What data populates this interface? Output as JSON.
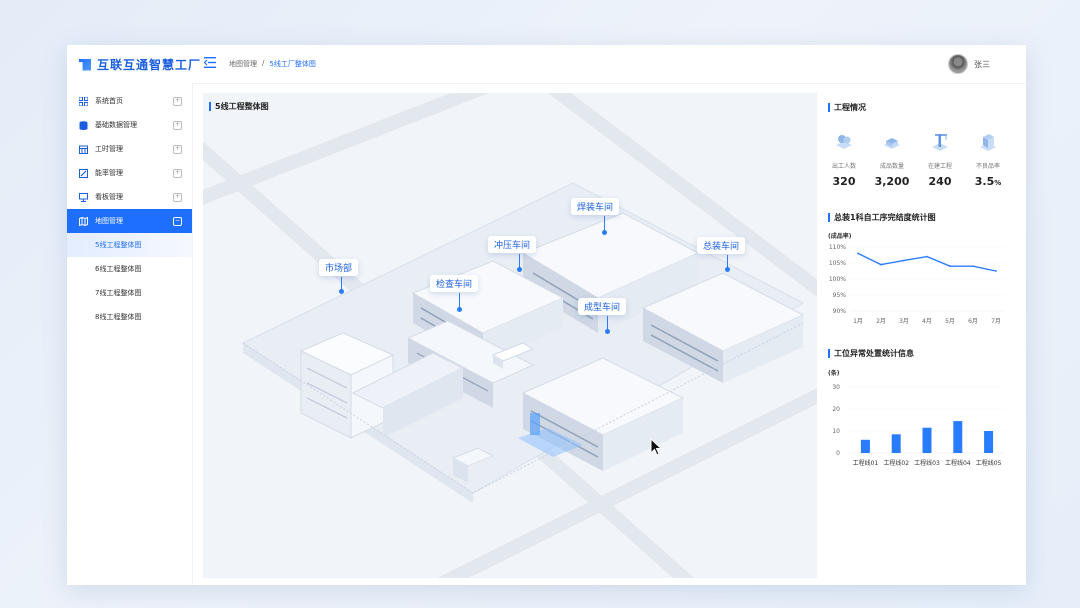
{
  "app": {
    "title": "互联互通智慧工厂"
  },
  "header": {
    "breadcrumb": [
      "地图管理",
      "/",
      "5线工厂整体图"
    ],
    "user_name": "张三"
  },
  "sidebar": {
    "items": [
      {
        "label": "系统首页",
        "icon": "grid-icon"
      },
      {
        "label": "基础数据管理",
        "icon": "database-icon"
      },
      {
        "label": "工时管理",
        "icon": "calendar-icon"
      },
      {
        "label": "能率管理",
        "icon": "chart-edit-icon"
      },
      {
        "label": "看板管理",
        "icon": "board-icon"
      },
      {
        "label": "地图管理",
        "icon": "map-icon",
        "active": true
      }
    ],
    "sub_items": [
      "5线工程整体图",
      "6线工程整体图",
      "7线工程整体图",
      "8线工程整体图"
    ]
  },
  "map": {
    "title": "5线工程整体图",
    "labels": [
      "焊装车间",
      "冲压车间",
      "总装车间",
      "市场部",
      "检查车间",
      "成型车间"
    ]
  },
  "panel": {
    "engineering_title": "工程情况",
    "stats": [
      {
        "label": "出工人数",
        "value": "320",
        "unit": ""
      },
      {
        "label": "成品数量",
        "value": "3,200",
        "unit": ""
      },
      {
        "label": "在建工程",
        "value": "240",
        "unit": ""
      },
      {
        "label": "不良品率",
        "value": "3.5",
        "unit": "%"
      }
    ],
    "line_chart_title": "总装1科自工序完结度统计图",
    "line_chart_unit": "(成品率)",
    "bar_chart_title": "工位异常处置统计信息",
    "bar_chart_unit": "(条)"
  },
  "chart_data": [
    {
      "type": "line",
      "title": "总装1科自工序完结度统计图",
      "ylabel": "(成品率)",
      "categories": [
        "1月",
        "2月",
        "3月",
        "4月",
        "5月",
        "6月",
        "7月"
      ],
      "values": [
        108,
        104.5,
        105.8,
        107,
        104,
        104,
        102.5
      ],
      "ylim": [
        90,
        110
      ],
      "yticks": [
        "90%",
        "95%",
        "100%",
        "105%",
        "110%"
      ],
      "grid": true,
      "color": "#2a7cff"
    },
    {
      "type": "bar",
      "title": "工位异常处置统计信息",
      "ylabel": "(条)",
      "categories": [
        "工程线01",
        "工程线02",
        "工程线03",
        "工程线04",
        "工程线05"
      ],
      "values": [
        6,
        8.5,
        11.5,
        14.5,
        10
      ],
      "ylim": [
        0,
        30
      ],
      "yticks": [
        "0",
        "10",
        "20",
        "30"
      ],
      "grid": true,
      "color": "#2a7cff"
    }
  ]
}
